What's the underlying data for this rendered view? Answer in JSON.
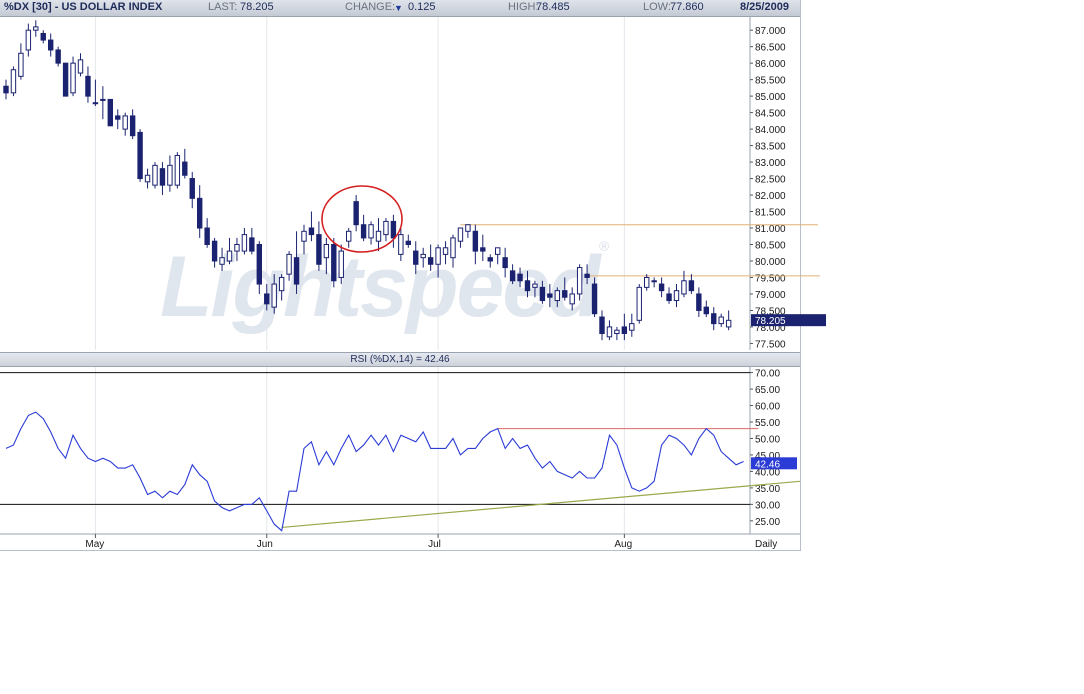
{
  "header": {
    "symbol": "%DX [30] - US DOLLAR INDEX",
    "last_label": "LAST:",
    "last_value": "78.205",
    "change_label": "CHANGE:",
    "change_value": "0.125",
    "high_label": "HIGH:",
    "high_value": "78.485",
    "low_label": "LOW:",
    "low_value": "77.860",
    "date": "8/25/2009"
  },
  "watermark": {
    "text": "Lightspeed",
    "mark": "®"
  },
  "rsi_label": "RSI (%DX,14) = 42.46",
  "colors": {
    "candle_down": "#1b2370",
    "candle_up": "#ffffff",
    "rsi_line": "#2a3bd6",
    "trend_olive": "#9aa84a",
    "resistance_orange": "#e0b074",
    "rsi_red": "#e06a6a",
    "circle": "#d42020",
    "price_tag": "#1b2370"
  },
  "chart_data": [
    {
      "type": "candlestick",
      "title": "%DX [30] - US DOLLAR INDEX",
      "timeframe": "Daily",
      "x_labels": [
        "May",
        "Jun",
        "Jul",
        "Aug",
        "Daily"
      ],
      "y_ticks": [
        "87.000",
        "86.500",
        "86.000",
        "85.500",
        "85.000",
        "84.500",
        "84.000",
        "83.500",
        "83.000",
        "82.500",
        "82.000",
        "81.500",
        "81.000",
        "80.500",
        "80.000",
        "79.500",
        "79.000",
        "78.500",
        "78.000",
        "77.500"
      ],
      "ylim": [
        77.3,
        87.4
      ],
      "last_price_tag": "78.205",
      "candles": [
        [
          85.3,
          85.5,
          84.9,
          85.1
        ],
        [
          85.1,
          85.9,
          85.0,
          85.8
        ],
        [
          85.6,
          86.6,
          85.5,
          86.3
        ],
        [
          86.4,
          87.2,
          86.2,
          87.0
        ],
        [
          87.0,
          87.3,
          86.8,
          87.1
        ],
        [
          86.9,
          87.0,
          86.6,
          86.7
        ],
        [
          86.7,
          86.9,
          86.2,
          86.4
        ],
        [
          86.4,
          86.5,
          85.9,
          86.0
        ],
        [
          86.0,
          86.0,
          85.0,
          85.0
        ],
        [
          85.1,
          86.2,
          85.0,
          86.0
        ],
        [
          85.7,
          86.3,
          85.6,
          86.1
        ],
        [
          85.6,
          85.9,
          84.8,
          85.0
        ],
        [
          84.8,
          85.5,
          84.7,
          84.8
        ],
        [
          84.9,
          85.3,
          84.3,
          84.9
        ],
        [
          84.9,
          84.9,
          84.1,
          84.1
        ],
        [
          84.4,
          84.6,
          84.0,
          84.3
        ],
        [
          84.0,
          84.5,
          83.8,
          84.4
        ],
        [
          84.4,
          84.6,
          83.7,
          83.8
        ],
        [
          83.9,
          84.0,
          82.4,
          82.5
        ],
        [
          82.4,
          82.8,
          82.2,
          82.6
        ],
        [
          82.3,
          83.0,
          82.2,
          82.9
        ],
        [
          82.8,
          83.0,
          82.0,
          82.3
        ],
        [
          82.3,
          83.2,
          82.1,
          82.9
        ],
        [
          82.3,
          83.3,
          82.2,
          83.2
        ],
        [
          83.0,
          83.4,
          82.5,
          82.6
        ],
        [
          82.5,
          82.7,
          81.6,
          81.9
        ],
        [
          81.9,
          82.3,
          80.7,
          81.0
        ],
        [
          81.0,
          81.3,
          80.4,
          80.5
        ],
        [
          80.6,
          80.7,
          79.8,
          80.0
        ],
        [
          79.9,
          80.4,
          79.7,
          80.1
        ],
        [
          80.0,
          80.7,
          79.9,
          80.3
        ],
        [
          80.3,
          80.7,
          80.0,
          80.5
        ],
        [
          80.3,
          81.0,
          80.2,
          80.8
        ],
        [
          80.7,
          81.0,
          80.2,
          80.3
        ],
        [
          80.5,
          80.6,
          79.0,
          79.3
        ],
        [
          79.0,
          79.3,
          78.5,
          78.7
        ],
        [
          78.6,
          79.6,
          78.4,
          79.3
        ],
        [
          79.1,
          79.6,
          78.8,
          79.5
        ],
        [
          79.6,
          80.3,
          79.4,
          80.2
        ],
        [
          80.1,
          80.9,
          79.0,
          79.3
        ],
        [
          80.6,
          81.1,
          80.2,
          80.9
        ],
        [
          81.0,
          81.5,
          80.6,
          80.8
        ],
        [
          80.8,
          81.2,
          79.7,
          79.9
        ],
        [
          80.1,
          80.7,
          79.6,
          80.5
        ],
        [
          80.5,
          80.7,
          79.2,
          79.4
        ],
        [
          79.5,
          80.5,
          79.3,
          80.3
        ],
        [
          80.6,
          81.0,
          80.4,
          80.9
        ],
        [
          81.8,
          82.0,
          80.9,
          81.1
        ],
        [
          81.1,
          81.4,
          80.6,
          80.7
        ],
        [
          80.7,
          81.2,
          80.5,
          81.1
        ],
        [
          80.6,
          81.3,
          80.3,
          80.9
        ],
        [
          80.8,
          81.3,
          80.6,
          81.2
        ],
        [
          81.2,
          81.4,
          80.4,
          80.7
        ],
        [
          80.2,
          81.0,
          80.0,
          80.8
        ],
        [
          80.6,
          80.8,
          80.4,
          80.5
        ],
        [
          80.3,
          80.6,
          79.6,
          79.9
        ],
        [
          80.1,
          80.4,
          79.8,
          80.2
        ],
        [
          80.1,
          80.5,
          79.7,
          79.9
        ],
        [
          79.9,
          80.5,
          79.5,
          80.4
        ],
        [
          80.2,
          80.6,
          79.9,
          80.4
        ],
        [
          80.1,
          80.8,
          79.8,
          80.7
        ],
        [
          80.6,
          81.0,
          80.4,
          81.0
        ],
        [
          80.9,
          81.1,
          80.7,
          81.1
        ],
        [
          80.9,
          81.1,
          79.9,
          80.3
        ],
        [
          80.4,
          80.8,
          80.0,
          80.3
        ],
        [
          80.1,
          80.2,
          79.8,
          80.0
        ],
        [
          80.2,
          80.4,
          79.9,
          80.4
        ],
        [
          80.1,
          80.4,
          79.5,
          79.8
        ],
        [
          79.7,
          79.9,
          79.3,
          79.4
        ],
        [
          79.6,
          79.8,
          79.2,
          79.4
        ],
        [
          79.4,
          79.7,
          78.9,
          79.1
        ],
        [
          79.2,
          79.4,
          78.9,
          79.3
        ],
        [
          79.2,
          79.4,
          78.7,
          78.8
        ],
        [
          79.0,
          79.3,
          78.6,
          78.9
        ],
        [
          78.8,
          79.2,
          78.6,
          79.1
        ],
        [
          79.1,
          79.5,
          78.8,
          78.9
        ],
        [
          78.7,
          79.2,
          78.5,
          79.0
        ],
        [
          79.0,
          79.9,
          78.8,
          79.8
        ],
        [
          79.6,
          79.9,
          79.3,
          79.5
        ],
        [
          79.3,
          79.5,
          78.3,
          78.4
        ],
        [
          78.3,
          78.5,
          77.6,
          77.8
        ],
        [
          77.7,
          78.2,
          77.6,
          78.0
        ],
        [
          77.8,
          78.0,
          77.6,
          77.9
        ],
        [
          78.0,
          78.4,
          77.6,
          77.8
        ],
        [
          77.9,
          78.4,
          77.7,
          78.1
        ],
        [
          78.2,
          79.3,
          78.1,
          79.2
        ],
        [
          79.2,
          79.6,
          79.1,
          79.5
        ],
        [
          79.4,
          79.5,
          79.2,
          79.4
        ],
        [
          79.3,
          79.5,
          78.9,
          79.1
        ],
        [
          79.0,
          79.2,
          78.7,
          78.8
        ],
        [
          78.8,
          79.3,
          78.6,
          79.1
        ],
        [
          79.0,
          79.7,
          78.9,
          79.4
        ],
        [
          79.4,
          79.6,
          79.0,
          79.1
        ],
        [
          79.0,
          79.2,
          78.3,
          78.5
        ],
        [
          78.6,
          78.8,
          78.3,
          78.4
        ],
        [
          78.4,
          78.6,
          77.9,
          78.1
        ],
        [
          78.1,
          78.4,
          78.0,
          78.3
        ],
        [
          78.0,
          78.5,
          77.9,
          78.2
        ]
      ],
      "reference_lines": [
        81.1,
        79.55
      ]
    },
    {
      "type": "line",
      "title": "RSI (%DX,14) = 42.46",
      "y_ticks": [
        "70.00",
        "65.00",
        "60.00",
        "55.00",
        "50.00",
        "45.00",
        "40.00",
        "35.00",
        "30.00",
        "25.00"
      ],
      "ylim": [
        21,
        72
      ],
      "reference_levels": [
        70,
        30
      ],
      "last_value_tag": "42.46",
      "values": [
        47,
        48,
        53,
        57,
        58,
        56,
        52,
        47,
        44,
        51,
        47,
        44,
        43,
        44,
        43,
        41,
        41,
        42,
        38,
        33,
        34,
        32,
        34,
        33,
        36,
        42,
        39,
        37,
        31,
        29,
        28,
        29,
        30,
        30,
        32,
        28,
        24,
        22,
        34,
        34,
        47,
        49,
        42,
        46,
        42,
        47,
        51,
        46,
        48,
        51,
        48,
        51,
        46,
        51,
        50,
        49,
        52,
        47,
        47,
        47,
        50,
        45,
        47,
        47,
        50,
        52,
        53,
        47,
        50,
        47,
        48,
        44,
        41,
        43,
        40,
        39,
        38,
        40,
        38,
        38,
        41,
        51,
        48,
        41,
        35,
        34,
        35,
        37,
        48,
        51,
        50,
        48,
        45,
        50,
        53,
        51,
        46,
        44,
        42,
        43
      ],
      "trend_lines": [
        {
          "x": [
            37,
            130
          ],
          "y": [
            23,
            37
          ]
        },
        {
          "x": [
            66,
            101
          ],
          "y": [
            53,
            53
          ]
        }
      ]
    }
  ]
}
